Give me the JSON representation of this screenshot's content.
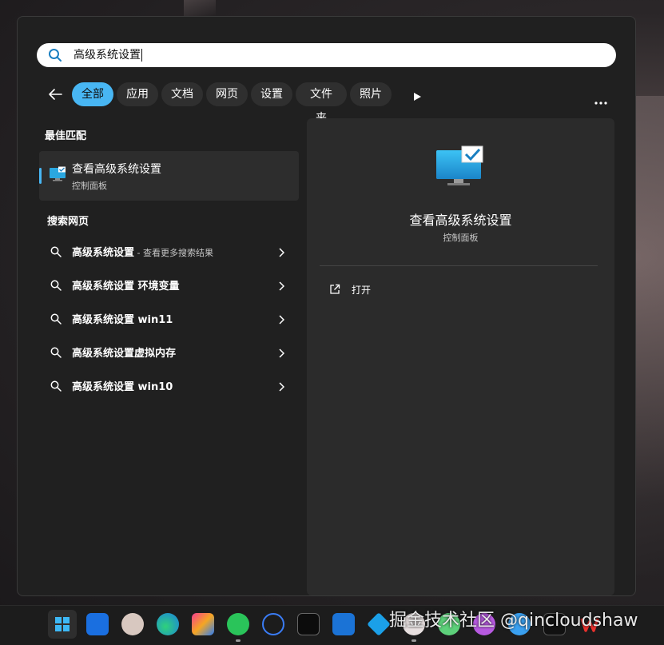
{
  "search": {
    "query": "高级系统设置"
  },
  "filters": {
    "tabs": [
      "全部",
      "应用",
      "文档",
      "网页",
      "设置",
      "文件夹",
      "照片"
    ],
    "active": "全部"
  },
  "best_match": {
    "section_title": "最佳匹配",
    "title": "查看高级系统设置",
    "subtitle": "控制面板"
  },
  "web_search": {
    "section_title": "搜索网页",
    "results": [
      {
        "query": "高级系统设置",
        "hint": " - 查看更多搜索结果"
      },
      {
        "query": "高级系统设置 环境变量",
        "hint": ""
      },
      {
        "query": "高级系统设置 win11",
        "hint": ""
      },
      {
        "query": "高级系统设置虚拟内存",
        "hint": ""
      },
      {
        "query": "高级系统设置 win10",
        "hint": ""
      }
    ]
  },
  "preview": {
    "title": "查看高级系统设置",
    "subtitle": "控制面板",
    "actions": [
      "打开"
    ]
  },
  "taskbar": {
    "icons": [
      "windows-start-icon",
      "app-icon",
      "avatar-app-icon",
      "edge-browser-icon",
      "jetbrains-ide-icon",
      "wechat-icon",
      "todo-check-icon",
      "terminal-icon",
      "outlook-icon",
      "bird-app-icon",
      "game-app-icon",
      "flower-app-icon",
      "smiley-app-icon",
      "c-app-icon",
      "capcut-icon",
      "wps-icon"
    ]
  },
  "watermark": "掘金技术社区 @qincloudshaw",
  "colors": {
    "accent": "#48b6f3",
    "panel_bg": "#202020",
    "preview_bg": "#2b2b2b"
  }
}
